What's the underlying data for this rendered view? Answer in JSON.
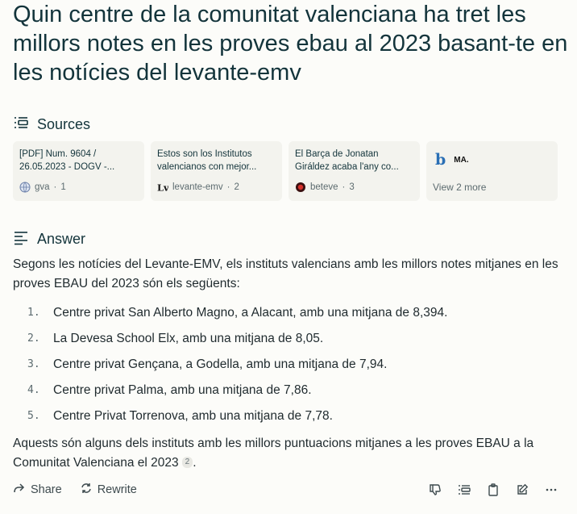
{
  "title": "Quin centre de la comunitat valenciana ha tret les millors notes en les proves ebau al 2023 basant-te en les notícies del levante-emv",
  "sources": {
    "heading": "Sources",
    "cards": [
      {
        "text": "[PDF] Num. 9604 / 26.05.2023 - DOGV -...",
        "site": "gva",
        "index": "1",
        "icon": "globe-icon"
      },
      {
        "text": "Estos son los Institutos valencianos con mejor...",
        "site": "levante-emv",
        "index": "2",
        "icon": "levante-emv-logo"
      },
      {
        "text": "El Barça de Jonatan Giráldez acaba l'any co...",
        "site": "beteve",
        "index": "3",
        "icon": "beteve-logo"
      }
    ],
    "more": {
      "label": "View 2 more",
      "logo_b": "b",
      "logo_ma": "MA."
    }
  },
  "answer": {
    "heading": "Answer",
    "intro": "Segons les notícies del Levante-EMV, els instituts valencians amb les millors notes mitjanes en les proves EBAU del 2023 són els següents:",
    "items": [
      {
        "num": "1.",
        "text": "Centre privat San Alberto Magno, a Alacant, amb una mitjana de 8,394."
      },
      {
        "num": "2.",
        "text": "La Devesa School Elx, amb una mitjana de 8,05."
      },
      {
        "num": "3.",
        "text": "Centre privat Gençana, a Godella, amb una mitjana de 7,94."
      },
      {
        "num": "4.",
        "text": "Centre privat Palma, amb una mitjana de 7,86."
      },
      {
        "num": "5.",
        "text": "Centre Privat Torrenova, amb una mitjana de 7,78."
      }
    ],
    "closing": "Aquests són alguns dels instituts amb les millors puntuacions mitjanes a les proves EBAU a la Comunitat Valenciana el 2023",
    "closing_cite": "2",
    "closing_end": "."
  },
  "footer": {
    "share": "Share",
    "rewrite": "Rewrite",
    "icons": [
      "thumbs-down-icon",
      "sources-list-icon",
      "copy-icon",
      "edit-icon",
      "more-icon"
    ]
  },
  "colors": {
    "background": "#fcfcf9",
    "card": "#f3f3ee",
    "text": "#13343b",
    "muted": "#5c6b6f",
    "beteve_red": "#d6312b"
  }
}
